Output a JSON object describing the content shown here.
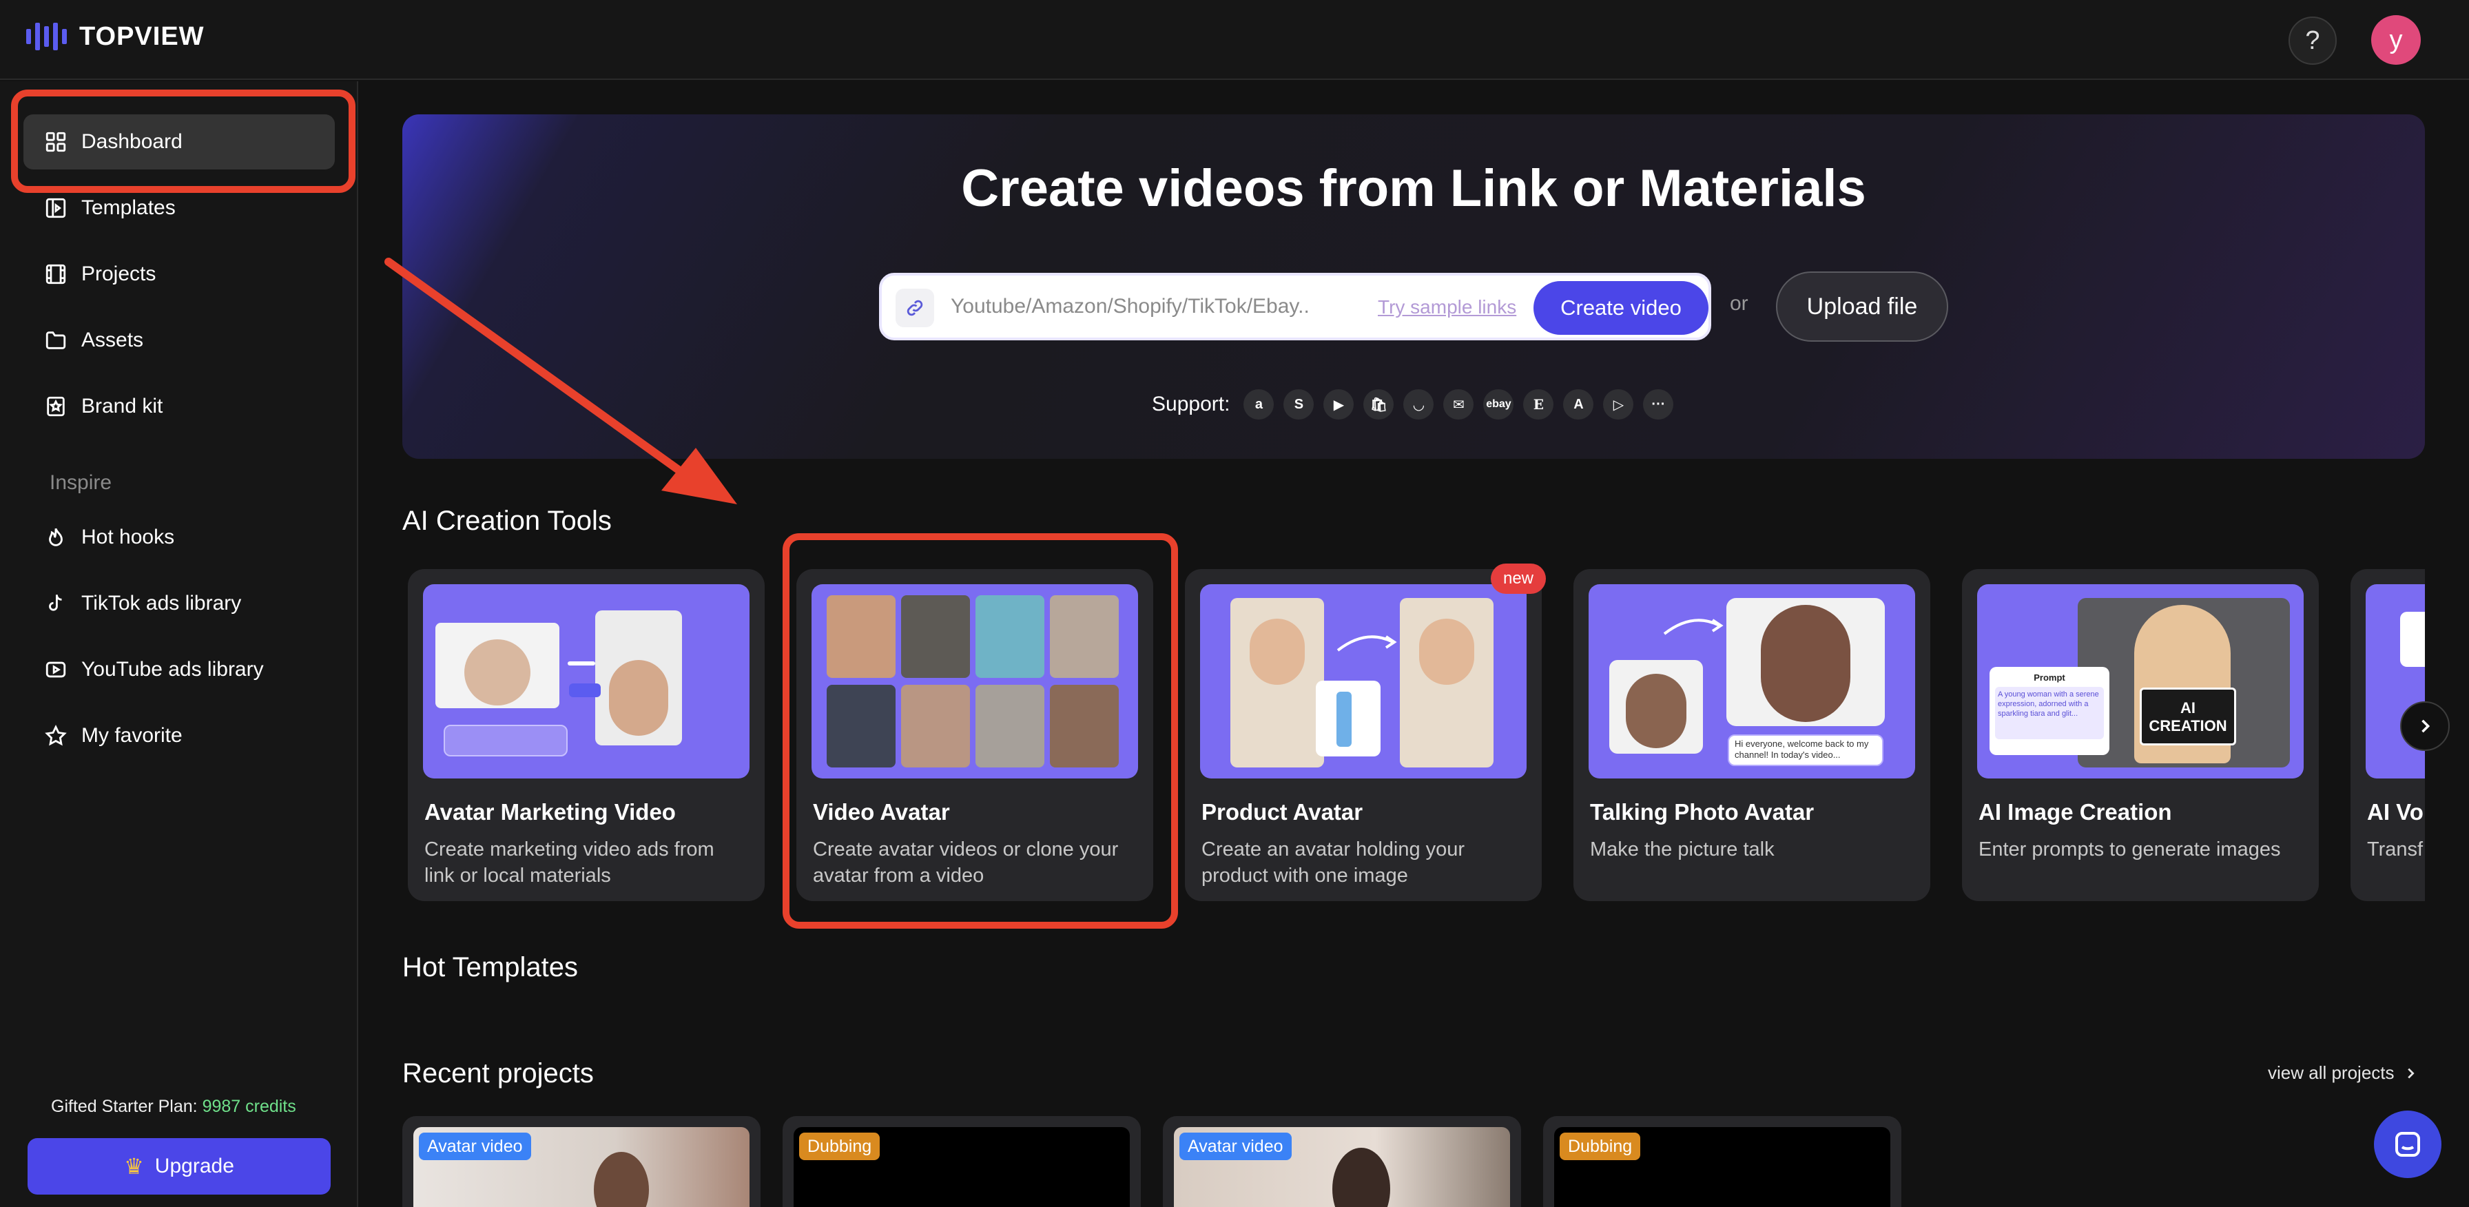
{
  "header": {
    "logo": "TOPVIEW",
    "help": "?",
    "avatar_initial": "y"
  },
  "sidebar": {
    "items": [
      {
        "label": "Dashboard",
        "icon": "grid-icon",
        "active": true
      },
      {
        "label": "Templates",
        "icon": "template-icon"
      },
      {
        "label": "Projects",
        "icon": "film-icon"
      },
      {
        "label": "Assets",
        "icon": "folder-icon"
      },
      {
        "label": "Brand kit",
        "icon": "star-bookmark-icon"
      }
    ],
    "inspire_label": "Inspire",
    "inspire_items": [
      {
        "label": "Hot hooks",
        "icon": "flame-icon"
      },
      {
        "label": "TikTok ads library",
        "icon": "tiktok-icon"
      },
      {
        "label": "YouTube ads library",
        "icon": "youtube-icon"
      },
      {
        "label": "My favorite",
        "icon": "star-icon"
      }
    ],
    "plan_label": "Gifted Starter Plan:",
    "plan_credits": "9987 credits",
    "upgrade_label": "Upgrade"
  },
  "hero": {
    "title": "Create videos from Link or Materials",
    "url_placeholder": "Youtube/Amazon/Shopify/TikTok/Ebay..",
    "sample_link": "Try sample links",
    "create_label": "Create video",
    "or_label": "or",
    "upload_label": "Upload file",
    "support_label": "Support:",
    "support_icons": [
      "a",
      "S",
      "▶",
      "🛍",
      "◡",
      "✉",
      "ebay",
      "E",
      "A",
      "▷",
      "···"
    ]
  },
  "tools": {
    "heading": "AI Creation Tools",
    "cards": [
      {
        "title": "Avatar Marketing Video",
        "desc": "Create marketing video ads from link or local materials"
      },
      {
        "title": "Video Avatar",
        "desc": "Create avatar videos or clone your avatar from a video"
      },
      {
        "title": "Product Avatar",
        "desc": "Create an avatar holding your product with one image"
      },
      {
        "title": "Talking Photo Avatar",
        "desc": "Make the picture talk"
      },
      {
        "title": "AI Image Creation",
        "desc": "Enter prompts to generate images"
      },
      {
        "title": "AI Vo",
        "desc": "Transf"
      }
    ],
    "new_badge": "new",
    "card_snippets": {
      "speech": "Hi everyone, welcome back to my channel! In today's video...",
      "prompt_label": "Prompt",
      "prompt_text": "A young woman with a serene expression, adorned with a sparkling tiara and glit...",
      "sign_text": "AI CREATION"
    }
  },
  "hot_templates": {
    "heading": "Hot Templates"
  },
  "recent": {
    "heading": "Recent projects",
    "view_all": "view all projects",
    "projects": [
      {
        "badge": "Avatar video",
        "badge_color": "#3b82f6"
      },
      {
        "badge": "Dubbing",
        "badge_color": "#d98a1f"
      },
      {
        "badge": "Avatar video",
        "badge_color": "#3b82f6"
      },
      {
        "badge": "Dubbing",
        "badge_color": "#d98a1f"
      }
    ]
  },
  "colors": {
    "accent": "#4b46e8",
    "annotation": "#e8412c",
    "credits": "#6fe08a"
  }
}
